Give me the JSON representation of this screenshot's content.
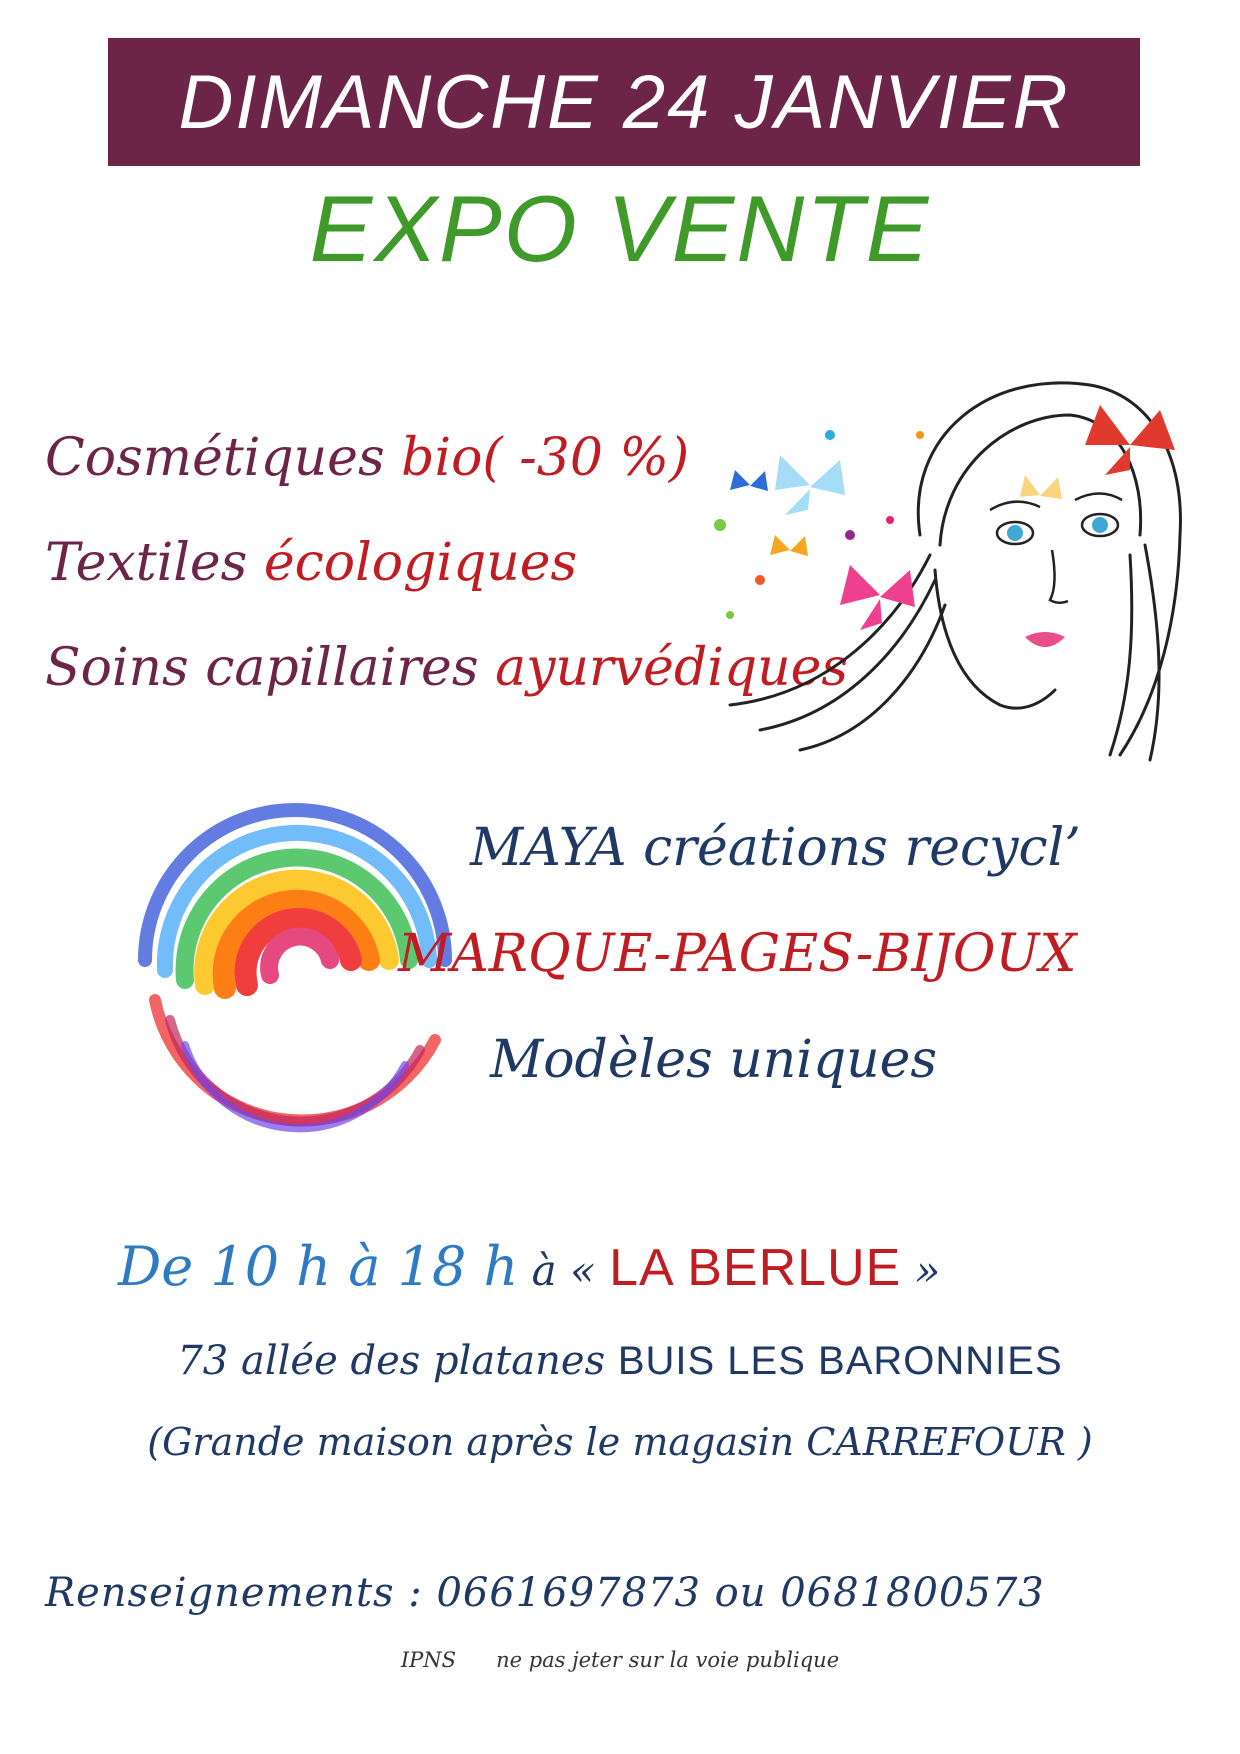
{
  "banner": {
    "date": "DIMANCHE 24 JANVIER",
    "title": "EXPO VENTE"
  },
  "products": [
    {
      "main": "Cosmétiques ",
      "highlight": "bio( -30 %)"
    },
    {
      "main": "Textiles ",
      "highlight": "écologiques"
    },
    {
      "main": "Soins capillaires ",
      "highlight": "ayurvédiques"
    }
  ],
  "maya": {
    "line1": "MAYA créations  recycl’",
    "line2": "MARQUE-PAGES-BIJOUX",
    "line3": "Modèles uniques"
  },
  "schedule": {
    "hours": "De  10 h  à  18 h",
    "prefix": " à « ",
    "venue": "LA BERLUE",
    "suffix": " »"
  },
  "address": {
    "street": "73 allée des platanes  ",
    "town": "BUIS LES BARONNIES",
    "directions": "(Grande maison après le magasin CARREFOUR )"
  },
  "contact": {
    "label": "Renseignements :  ",
    "phones": "0661697873  ou  0681800573"
  },
  "footer": {
    "ipns": "IPNS",
    "notice": "ne pas jeter sur la voie publique"
  },
  "colors": {
    "banner_bg": "#6c2448",
    "title_green": "#3f9a2a",
    "plum": "#6c2448",
    "red": "#c11c22",
    "navy": "#1f3864",
    "blue": "#2e7bc4"
  },
  "illustrations": {
    "face": "woman-face-with-butterflies",
    "spiral": "rainbow-spiral"
  }
}
